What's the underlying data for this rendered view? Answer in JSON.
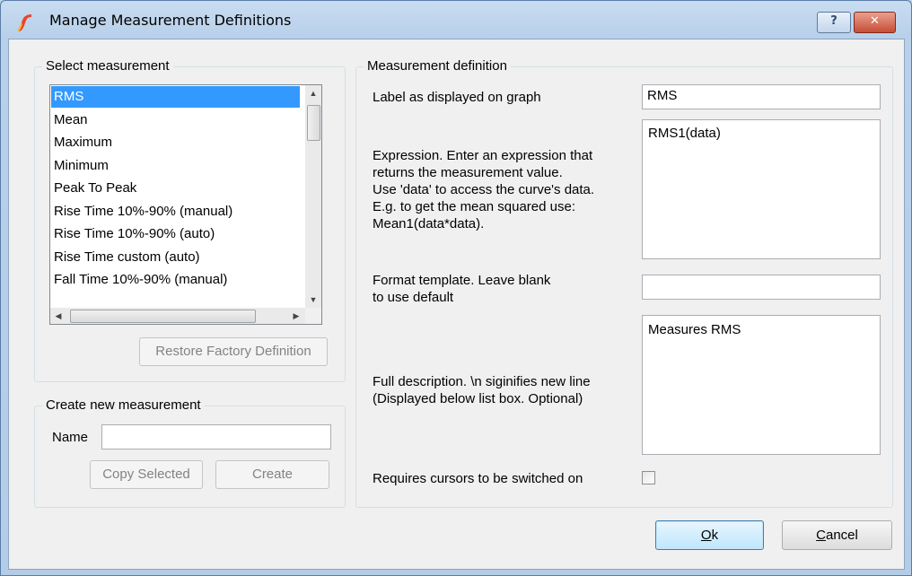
{
  "window": {
    "title": "Manage Measurement Definitions",
    "help_glyph": "?",
    "close_glyph": "✕"
  },
  "select_group": {
    "legend": "Select measurement",
    "items": [
      "RMS",
      "Mean",
      "Maximum",
      "Minimum",
      "Peak To Peak",
      "Rise Time 10%-90% (manual)",
      "Rise Time 10%-90% (auto)",
      "Rise Time custom (auto)",
      "Fall Time 10%-90% (manual)"
    ],
    "selected_index": 0,
    "restore_button": "Restore Factory Definition"
  },
  "create_group": {
    "legend": "Create new measurement",
    "name_label": "Name",
    "name_value": "",
    "copy_button": "Copy Selected",
    "create_button": "Create"
  },
  "definition_group": {
    "legend": "Measurement definition",
    "label_caption": "Label as displayed on graph",
    "label_value": "RMS",
    "expression_caption": "Expression. Enter an expression that\nreturns the measurement value.\nUse 'data' to access the curve's data.\nE.g. to get the mean squared use:\nMean1(data*data).",
    "expression_value": "RMS1(data)",
    "format_caption": "Format template. Leave blank\nto use default",
    "format_value": "",
    "description_caption": "Full description. \\n siginifies new line\n(Displayed below list box. Optional)",
    "description_value": "Measures RMS",
    "cursors_caption": "Requires cursors to be switched on",
    "cursors_checked": false
  },
  "footer": {
    "ok_key": "O",
    "ok_rest": "k",
    "cancel_key": "C",
    "cancel_rest": "ancel"
  },
  "colors": {
    "selection": "#3399ff",
    "title_bg": "#b9d1ea",
    "close_button": "#c74d36"
  }
}
